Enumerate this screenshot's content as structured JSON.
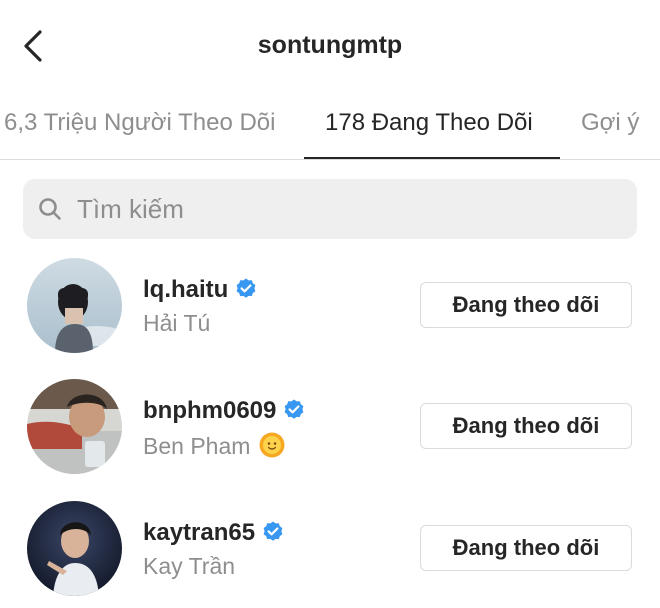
{
  "header": {
    "title": "sontungmtp",
    "back_icon": "back-chevron-icon"
  },
  "tabs": [
    {
      "label": "6,3 Triệu Người Theo Dõi",
      "active": false
    },
    {
      "label": "178 Đang Theo Dõi",
      "active": true
    },
    {
      "label": "Gợi ý",
      "active": false
    }
  ],
  "search": {
    "placeholder": "Tìm kiếm",
    "value": "",
    "icon": "search-icon"
  },
  "accounts": [
    {
      "username": "lq.haitu",
      "full_name": "Hải Tú",
      "verified": true,
      "button_label": "Đang theo dõi"
    },
    {
      "username": "bnphm0609",
      "full_name": "Ben Pham",
      "verified": true,
      "emoji": "sun-face-icon",
      "button_label": "Đang theo dõi"
    },
    {
      "username": "kaytran65",
      "full_name": "Kay Trần",
      "verified": true,
      "button_label": "Đang theo dõi"
    }
  ],
  "colors": {
    "verified_badge": "#3897f0",
    "secondary_text": "#8e8e8e",
    "search_bg": "#efeff0",
    "border": "#dbdbdb"
  }
}
